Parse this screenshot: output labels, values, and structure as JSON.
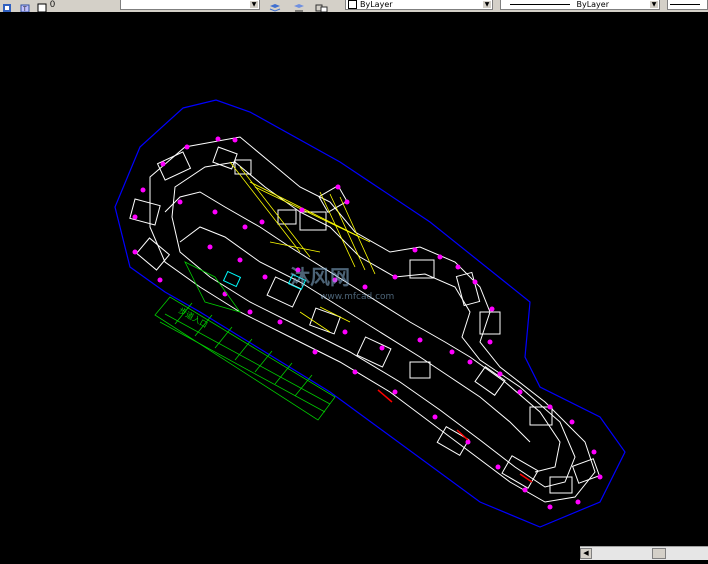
{
  "toolbar": {
    "layer_value": "0",
    "color_value": "ByLayer",
    "linetype_value": "ByLayer",
    "icons": [
      "layer-state-icon",
      "layer-properties-icon",
      "make-current-icon",
      "layer-previous-icon"
    ]
  },
  "drawing": {
    "label_entrance": "步道入口",
    "watermark_main": "沐风网",
    "watermark_sub": "www.mfcad.com",
    "colors": {
      "boundary": "#0000ff",
      "path": "#ffffff",
      "markers": "#ff00ff",
      "structures": "#ffff00",
      "stairs": "#00cc00",
      "accent_red": "#ff0000"
    }
  },
  "statusbar": {
    "scroll_left": "◀"
  }
}
